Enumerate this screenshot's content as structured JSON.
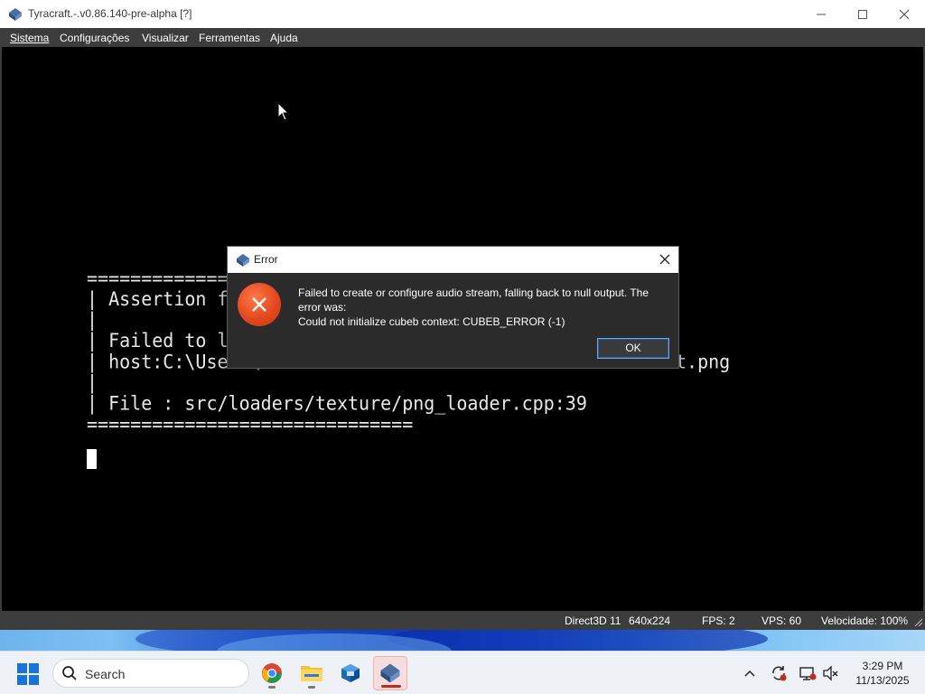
{
  "window": {
    "title": "Tyracraft.-.v0.86.140-pre-alpha [?]",
    "controls": {
      "minimize": "minimize",
      "maximize": "maximize",
      "close": "close"
    }
  },
  "menu": [
    {
      "label": "Sistema"
    },
    {
      "label": "Configurações"
    },
    {
      "label": "Visualizar"
    },
    {
      "label": "Ferramentas"
    },
    {
      "label": "Ajuda"
    }
  ],
  "console": {
    "lines": [
      "==============  T",
      "| Assertion faile",
      "|",
      "| Failed to load",
      "| host:C:\\Users\\V",
      "|",
      "| File : src/loaders/texture/png_loader.cpp:39",
      "=============================="
    ],
    "path_suffix": "t.png"
  },
  "dialog": {
    "title": "Error",
    "message_line1": "Failed to create or configure audio stream, falling back to null output. The",
    "message_line2": "error was:",
    "message_line3": "Could not initialize cubeb context: CUBEB_ERROR (-1)",
    "ok_label": "OK"
  },
  "status": {
    "renderer": "Direct3D 11",
    "resolution": "640x224",
    "fps": "FPS: 2",
    "vps": "VPS: 60",
    "speed": "Velocidade: 100%"
  },
  "taskbar": {
    "search_label": "Search",
    "apps": [
      "chrome-icon",
      "file-explorer-icon",
      "virtualbox-icon",
      "tyracraft-icon"
    ],
    "time": "3:29 PM",
    "date": "11/13/2025"
  },
  "colors": {
    "error_red": "#e5481f",
    "menu_bg": "#3c3c3c",
    "accent_blue": "#1e5fa8"
  }
}
